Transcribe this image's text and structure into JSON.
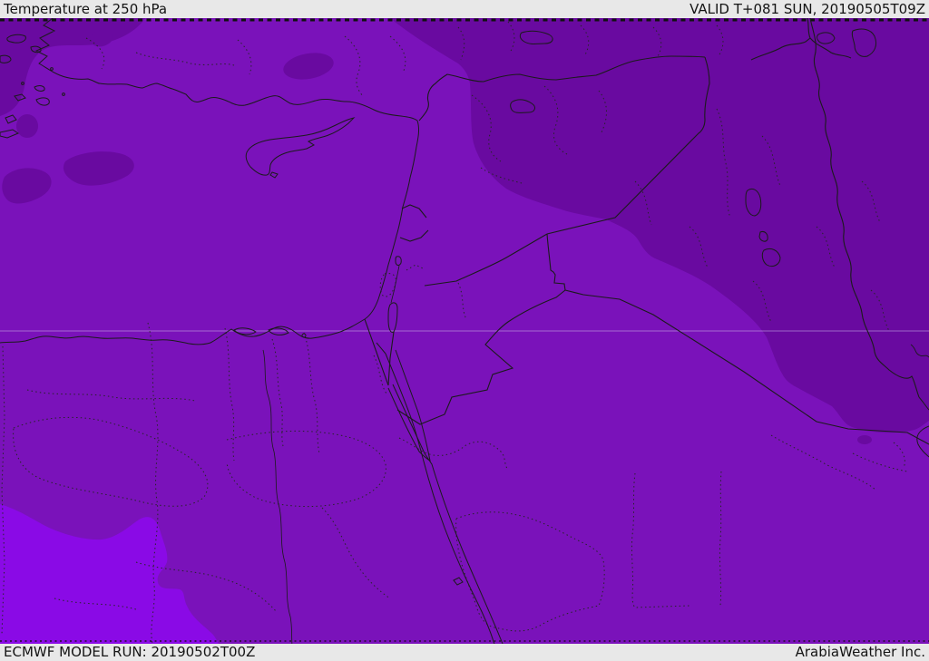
{
  "header": {
    "title": "Temperature at 250 hPa",
    "valid_label": "VALID T+081 SUN, 20190505T09Z"
  },
  "footer": {
    "model_run_label": "ECMWF MODEL RUN: 20190502T00Z",
    "brand_label": "ArabiaWeather Inc."
  },
  "map": {
    "colors": {
      "base": "#7A12BA",
      "darker": "#690AA0",
      "brighter": "#8A0AE6",
      "bar_background": "#E8E8E8",
      "bar_text": "#141414",
      "border_line": "#1B1B1B",
      "admin_dotted_line": "#262626",
      "latitude_line": "#C9B3E8"
    }
  }
}
